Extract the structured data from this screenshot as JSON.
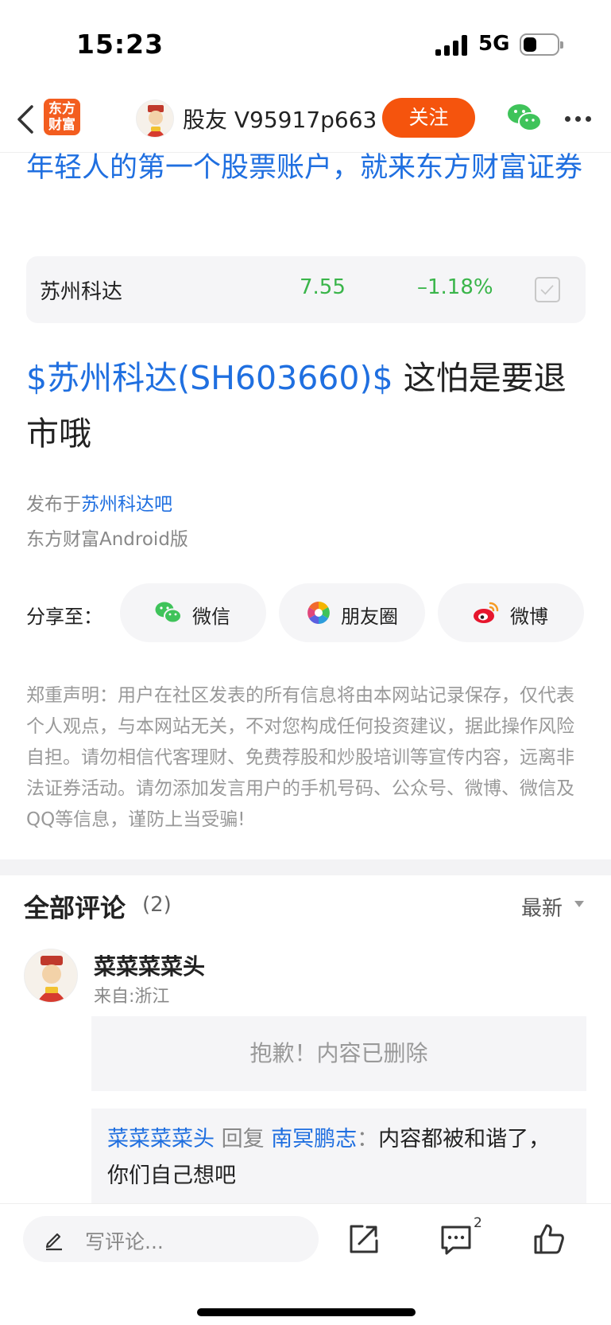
{
  "status_bar": {
    "time": "15:23",
    "network": "5G"
  },
  "nav": {
    "logo_line1": "东方",
    "logo_line2": "财富",
    "username": "股友 V95917p663",
    "follow_label": "关注"
  },
  "promo_text": "年轻人的第一个股票账户，就来东方财富证券",
  "stock": {
    "name": "苏州科达",
    "price": "7.55",
    "change": "–1.18%"
  },
  "post": {
    "tag": "$苏州科达(SH603660)$",
    "text": "  这怕是要退市哦",
    "published_prefix": "发布于",
    "bar_name": "苏州科达吧",
    "client": "东方财富Android版"
  },
  "share": {
    "label": "分享至：",
    "wechat": "微信",
    "moments": "朋友圈",
    "weibo": "微博"
  },
  "disclaimer": "郑重声明：用户在社区发表的所有信息将由本网站记录保存，仅代表个人观点，与本网站无关，不对您构成任何投资建议，据此操作风险自担。请勿相信代客理财、免费荐股和炒股培训等宣传内容，远离非法证券活动。请勿添加发言用户的手机号码、公众号、微博、微信及QQ等信息，谨防上当受骗!",
  "comments": {
    "title": "全部评论",
    "count": "(2)",
    "sort": "最新",
    "items": [
      {
        "user": "菜菜菜菜头",
        "location": "来自:浙江",
        "deleted_text": "抱歉！内容已删除",
        "reply": {
          "from": "菜菜菜菜头",
          "verb": " 回复 ",
          "to": "南冥鹏志",
          "sep": "：",
          "text": "内容都被和谐了，你们自己想吧"
        }
      }
    ]
  },
  "bottom_bar": {
    "placeholder": "写评论...",
    "comment_badge": "2"
  },
  "colors": {
    "accent": "#f5540d",
    "link": "#1f6fe0",
    "down": "#3ab54a"
  }
}
